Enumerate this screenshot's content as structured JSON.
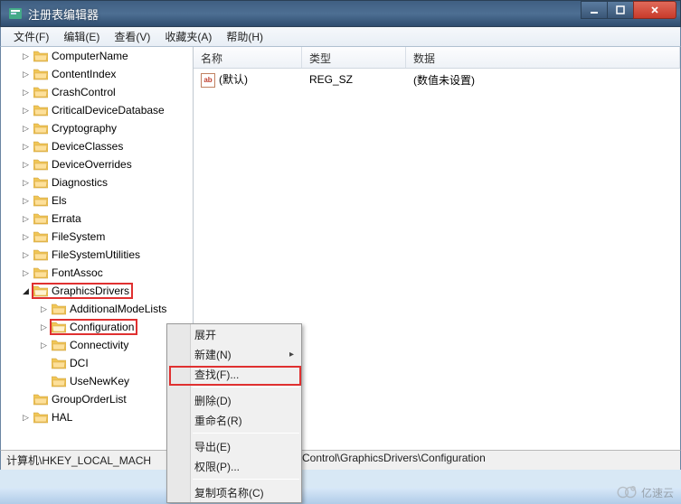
{
  "window": {
    "title": "注册表编辑器"
  },
  "menu": {
    "file": "文件(F)",
    "edit": "编辑(E)",
    "view": "查看(V)",
    "favorites": "收藏夹(A)",
    "help": "帮助(H)"
  },
  "tree": {
    "items": [
      {
        "label": "ComputerName",
        "depth": 1,
        "exp": "▷"
      },
      {
        "label": "ContentIndex",
        "depth": 1,
        "exp": "▷"
      },
      {
        "label": "CrashControl",
        "depth": 1,
        "exp": "▷"
      },
      {
        "label": "CriticalDeviceDatabase",
        "depth": 1,
        "exp": "▷"
      },
      {
        "label": "Cryptography",
        "depth": 1,
        "exp": "▷"
      },
      {
        "label": "DeviceClasses",
        "depth": 1,
        "exp": "▷"
      },
      {
        "label": "DeviceOverrides",
        "depth": 1,
        "exp": "▷"
      },
      {
        "label": "Diagnostics",
        "depth": 1,
        "exp": "▷"
      },
      {
        "label": "Els",
        "depth": 1,
        "exp": "▷"
      },
      {
        "label": "Errata",
        "depth": 1,
        "exp": "▷"
      },
      {
        "label": "FileSystem",
        "depth": 1,
        "exp": "▷"
      },
      {
        "label": "FileSystemUtilities",
        "depth": 1,
        "exp": "▷"
      },
      {
        "label": "FontAssoc",
        "depth": 1,
        "exp": "▷"
      },
      {
        "label": "GraphicsDrivers",
        "depth": 1,
        "exp": "◢",
        "open": true,
        "hl": true
      },
      {
        "label": "AdditionalModeLists",
        "depth": 2,
        "exp": "▷"
      },
      {
        "label": "Configuration",
        "depth": 2,
        "exp": "▷",
        "open": true,
        "hl": true
      },
      {
        "label": "Connectivity",
        "depth": 2,
        "exp": "▷"
      },
      {
        "label": "DCI",
        "depth": 2,
        "exp": ""
      },
      {
        "label": "UseNewKey",
        "depth": 2,
        "exp": ""
      },
      {
        "label": "GroupOrderList",
        "depth": 1,
        "exp": ""
      },
      {
        "label": "HAL",
        "depth": 1,
        "exp": "▷"
      }
    ]
  },
  "list": {
    "headers": {
      "name": "名称",
      "type": "类型",
      "data": "数据"
    },
    "rows": [
      {
        "name": "(默认)",
        "type": "REG_SZ",
        "data": "(数值未设置)"
      }
    ]
  },
  "context_menu": {
    "expand": "展开",
    "new": "新建(N)",
    "find": "查找(F)...",
    "delete": "删除(D)",
    "rename": "重命名(R)",
    "export": "导出(E)",
    "permissions": "权限(P)...",
    "copy_key_name": "复制项名称(C)"
  },
  "statusbar": {
    "path_left": "计算机\\HKEY_LOCAL_MACH",
    "path_right": "Control\\GraphicsDrivers\\Configuration"
  },
  "watermark": {
    "text": "亿速云"
  }
}
